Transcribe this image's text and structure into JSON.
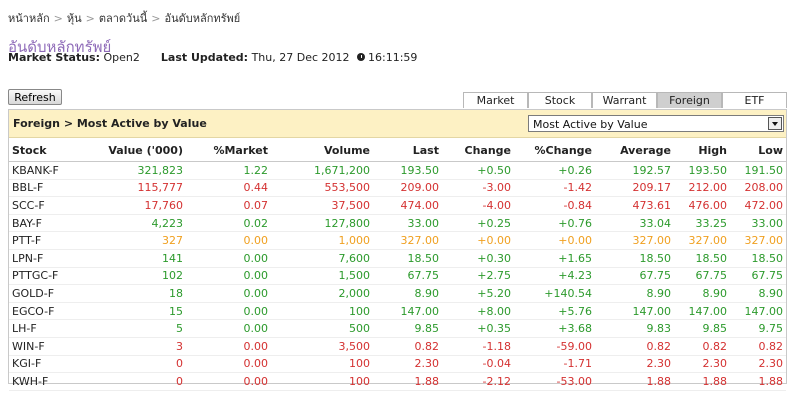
{
  "breadcrumb": [
    "หน้าหลัก",
    "หุ้น",
    "ตลาดวันนี้",
    "อันดับหลักทรัพย์"
  ],
  "breadcrumb_sep": ">",
  "page_title": "อันดับหลักทรัพย์",
  "status": {
    "market_label": "Market Status:",
    "market_value": "Open2",
    "updated_label": "Last Updated:",
    "updated_value": "Thu, 27 Dec 2012",
    "time": "16:11:59"
  },
  "refresh_label": "Refresh",
  "tabs": [
    "Market",
    "Stock",
    "Warrant",
    "Foreign",
    "ETF"
  ],
  "active_tab": "Foreign",
  "panel_title": "Foreign > Most Active by Value",
  "dropdown_value": "Most Active by Value",
  "columns": [
    "Stock",
    "Value ('000)",
    "%Market",
    "Volume",
    "Last",
    "Change",
    "%Change",
    "Average",
    "High",
    "Low"
  ],
  "rows": [
    {
      "c": "g",
      "v": [
        "KBANK-F",
        "321,823",
        "1.22",
        "1,671,200",
        "193.50",
        "+0.50",
        "+0.26",
        "192.57",
        "193.50",
        "191.50"
      ]
    },
    {
      "c": "rd",
      "v": [
        "BBL-F",
        "115,777",
        "0.44",
        "553,500",
        "209.00",
        "-3.00",
        "-1.42",
        "209.17",
        "212.00",
        "208.00"
      ]
    },
    {
      "c": "rd",
      "v": [
        "SCC-F",
        "17,760",
        "0.07",
        "37,500",
        "474.00",
        "-4.00",
        "-0.84",
        "473.61",
        "476.00",
        "472.00"
      ]
    },
    {
      "c": "g",
      "v": [
        "BAY-F",
        "4,223",
        "0.02",
        "127,800",
        "33.00",
        "+0.25",
        "+0.76",
        "33.04",
        "33.25",
        "33.00"
      ]
    },
    {
      "c": "o",
      "v": [
        "PTT-F",
        "327",
        "0.00",
        "1,000",
        "327.00",
        "+0.00",
        "+0.00",
        "327.00",
        "327.00",
        "327.00"
      ]
    },
    {
      "c": "g",
      "v": [
        "LPN-F",
        "141",
        "0.00",
        "7,600",
        "18.50",
        "+0.30",
        "+1.65",
        "18.50",
        "18.50",
        "18.50"
      ]
    },
    {
      "c": "g",
      "v": [
        "PTTGC-F",
        "102",
        "0.00",
        "1,500",
        "67.75",
        "+2.75",
        "+4.23",
        "67.75",
        "67.75",
        "67.75"
      ]
    },
    {
      "c": "g",
      "v": [
        "GOLD-F",
        "18",
        "0.00",
        "2,000",
        "8.90",
        "+5.20",
        "+140.54",
        "8.90",
        "8.90",
        "8.90"
      ]
    },
    {
      "c": "g",
      "v": [
        "EGCO-F",
        "15",
        "0.00",
        "100",
        "147.00",
        "+8.00",
        "+5.76",
        "147.00",
        "147.00",
        "147.00"
      ]
    },
    {
      "c": "g",
      "v": [
        "LH-F",
        "5",
        "0.00",
        "500",
        "9.85",
        "+0.35",
        "+3.68",
        "9.83",
        "9.85",
        "9.75"
      ]
    },
    {
      "c": "rd",
      "v": [
        "WIN-F",
        "3",
        "0.00",
        "3,500",
        "0.82",
        "-1.18",
        "-59.00",
        "0.82",
        "0.82",
        "0.82"
      ]
    },
    {
      "c": "rd",
      "v": [
        "KGI-F",
        "0",
        "0.00",
        "100",
        "2.30",
        "-0.04",
        "-1.71",
        "2.30",
        "2.30",
        "2.30"
      ]
    },
    {
      "c": "rd",
      "v": [
        "KWH-F",
        "0",
        "0.00",
        "100",
        "1.88",
        "-2.12",
        "-53.00",
        "1.88",
        "1.88",
        "1.88"
      ]
    }
  ],
  "colors": {
    "up": "#2c9a2c",
    "down": "#d43131",
    "unchanged": "#f0a020",
    "title": "#8e6ab8",
    "header_bg": "#fdf1c4"
  }
}
